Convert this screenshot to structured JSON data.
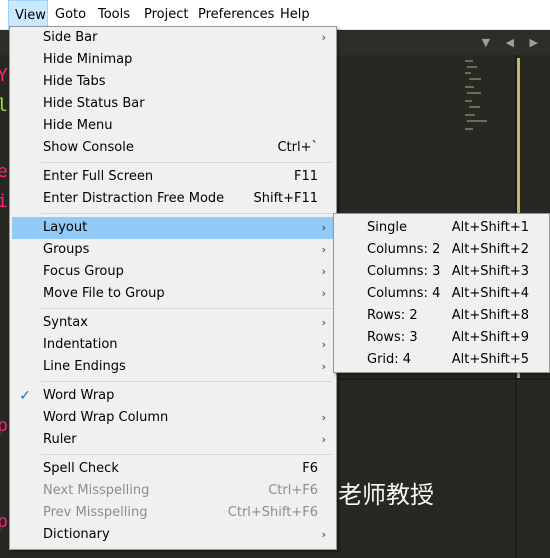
{
  "menubar": {
    "items": [
      {
        "label": "View"
      },
      {
        "label": "Goto"
      },
      {
        "label": "Tools"
      },
      {
        "label": "Project"
      },
      {
        "label": "Preferences"
      },
      {
        "label": "Help"
      }
    ]
  },
  "view_menu": {
    "items": [
      {
        "label": "Side Bar",
        "submenu": true
      },
      {
        "label": "Hide Minimap"
      },
      {
        "label": "Hide Tabs"
      },
      {
        "label": "Hide Status Bar"
      },
      {
        "label": "Hide Menu"
      },
      {
        "label": "Show Console",
        "shortcut": "Ctrl+`"
      },
      {
        "label": "Enter Full Screen",
        "shortcut": "F11"
      },
      {
        "label": "Enter Distraction Free Mode",
        "shortcut": "Shift+F11"
      },
      {
        "label": "Layout",
        "submenu": true
      },
      {
        "label": "Groups",
        "submenu": true
      },
      {
        "label": "Focus Group",
        "submenu": true
      },
      {
        "label": "Move File to Group",
        "submenu": true
      },
      {
        "label": "Syntax",
        "submenu": true
      },
      {
        "label": "Indentation",
        "submenu": true
      },
      {
        "label": "Line Endings",
        "submenu": true
      },
      {
        "label": "Word Wrap",
        "checked": true
      },
      {
        "label": "Word Wrap Column",
        "submenu": true
      },
      {
        "label": "Ruler",
        "submenu": true
      },
      {
        "label": "Spell Check",
        "shortcut": "F6"
      },
      {
        "label": "Next Misspelling",
        "shortcut": "Ctrl+F6",
        "disabled": true
      },
      {
        "label": "Prev Misspelling",
        "shortcut": "Ctrl+Shift+F6",
        "disabled": true
      },
      {
        "label": "Dictionary",
        "submenu": true
      }
    ]
  },
  "layout_submenu": {
    "items": [
      {
        "label": "Single",
        "shortcut": "Alt+Shift+1"
      },
      {
        "label": "Columns: 2",
        "shortcut": "Alt+Shift+2"
      },
      {
        "label": "Columns: 3",
        "shortcut": "Alt+Shift+3"
      },
      {
        "label": "Columns: 4",
        "shortcut": "Alt+Shift+4"
      },
      {
        "label": "Rows: 2",
        "shortcut": "Alt+Shift+8"
      },
      {
        "label": "Rows: 3",
        "shortcut": "Alt+Shift+9"
      },
      {
        "label": "Grid: 4",
        "shortcut": "Alt+Shift+5"
      }
    ]
  },
  "editor": {
    "background_text": "老师教授"
  },
  "colors": {
    "editor_bg": "#272822",
    "menu_bg": "#f0f0f0",
    "highlight": "#91c9f7",
    "check": "#1a73c9"
  }
}
